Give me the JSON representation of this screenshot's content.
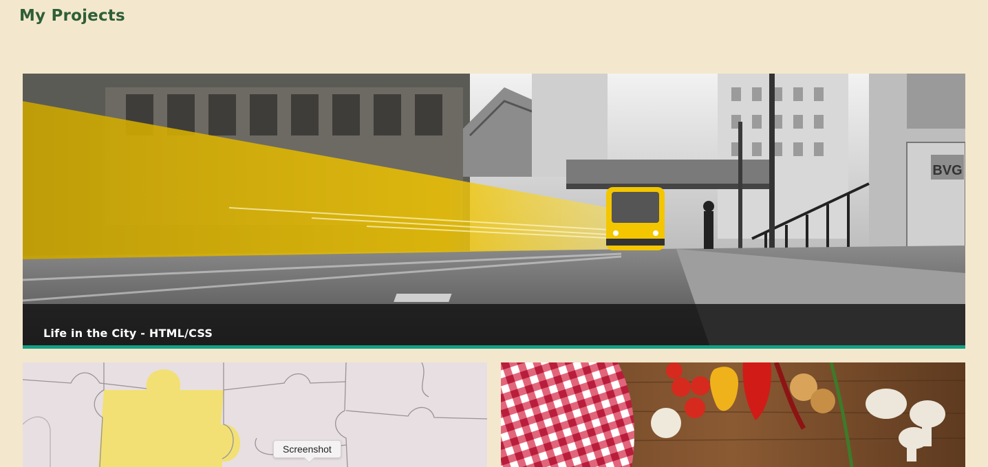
{
  "header": {
    "title": "My Projects"
  },
  "projects": [
    {
      "caption": "Life in the City - HTML/CSS",
      "image": "city-tram-photo",
      "sign_text": "BVG"
    },
    {
      "caption": "",
      "image": "puzzle-pieces-photo"
    },
    {
      "caption": "",
      "image": "vegetables-on-table-photo"
    }
  ],
  "tooltip": {
    "text": "Screenshot"
  },
  "colors": {
    "background": "#f3e8cd",
    "title": "#2e5e37",
    "accent": "#13a085",
    "caption_bg": "#121212"
  }
}
